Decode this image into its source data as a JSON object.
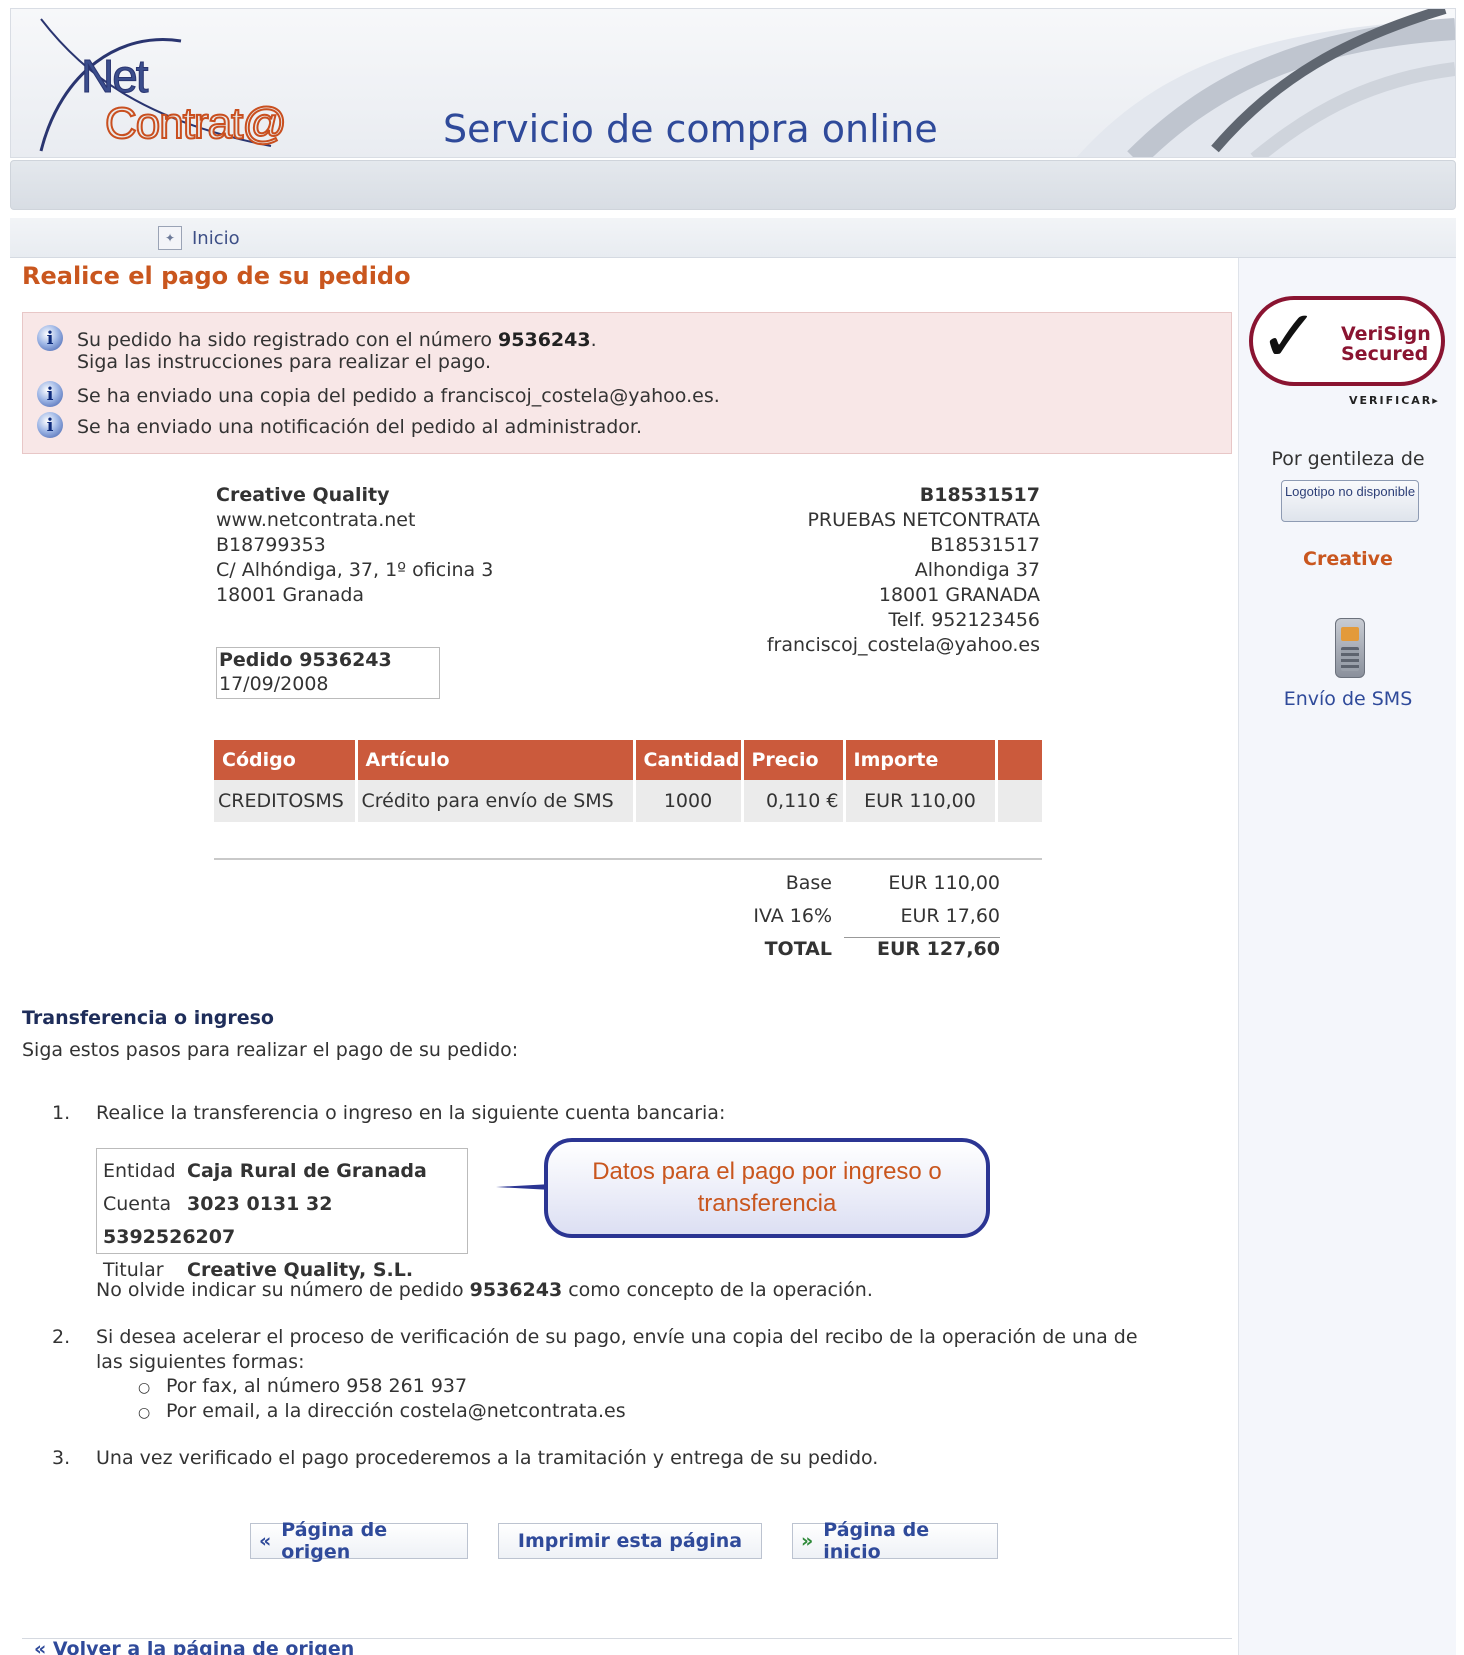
{
  "header": {
    "logo_top": "Net",
    "logo_bottom": "Contrat@",
    "title": "Servicio de compra online"
  },
  "nav": {
    "home_label": "Inicio"
  },
  "page_title": "Realice el pago de su pedido",
  "messages": {
    "m1_prefix": "Su pedido ha sido registrado con el número ",
    "m1_number": "9536243",
    "m1_suffix": ".",
    "m1_line2": "Siga las instrucciones para realizar el pago.",
    "m2": "Se ha enviado una copia del pedido a franciscoj_costela@yahoo.es.",
    "m3": "Se ha enviado una notificación del pedido al administrador."
  },
  "seller": {
    "name": "Creative Quality",
    "web": "www.netcontrata.net",
    "cif": "B18799353",
    "address": "C/ Alhóndiga, 37, 1º oficina 3",
    "city": "18001 Granada"
  },
  "buyer": {
    "id": "B18531517",
    "name": "PRUEBAS NETCONTRATA",
    "cif": "B18531517",
    "address": "Alhondiga 37",
    "city": "18001 GRANADA",
    "phone": "Telf. 952123456",
    "email": "franciscoj_costela@yahoo.es"
  },
  "order": {
    "label": "Pedido 9536243",
    "date": "17/09/2008"
  },
  "items_table": {
    "headers": [
      "Código",
      "Artículo",
      "Cantidad",
      "Precio",
      "Importe"
    ],
    "rows": [
      {
        "codigo": "CREDITOSMS",
        "articulo": "Crédito para envío de SMS",
        "cantidad": "1000",
        "precio": "0,110 €",
        "importe": "EUR 110,00"
      }
    ]
  },
  "totals": {
    "base_label": "Base",
    "base_value": "EUR 110,00",
    "iva_label": "IVA 16%",
    "iva_value": "EUR 17,60",
    "total_label": "TOTAL",
    "total_value": "EUR 127,60"
  },
  "payment": {
    "title": "Transferencia o ingreso",
    "intro": "Siga estos pasos para realizar el pago de su pedido:",
    "step1_num": "1.",
    "step1": "Realice la transferencia o ingreso en la siguiente cuenta bancaria:",
    "bank": {
      "entidad_label": "Entidad",
      "entidad": "Caja Rural de Granada",
      "cuenta_label": "Cuenta",
      "cuenta": "3023 0131 32 5392526207",
      "titular_label": "Titular",
      "titular": "Creative Quality, S.L."
    },
    "callout": "Datos para el pago por ingreso o transferencia",
    "reminder_prefix": "No olvide indicar su número de pedido ",
    "reminder_number": "9536243",
    "reminder_suffix": " como concepto de la operación.",
    "step2_num": "2.",
    "step2_line1": "Si desea acelerar el proceso de verificación de su pago, envíe una copia del recibo de la operación de una de",
    "step2_line2": "las siguientes formas:",
    "sub1": "Por fax, al número 958 261 937",
    "sub2": "Por email, a la dirección costela@netcontrata.es",
    "step3_num": "3.",
    "step3": "Una vez verificado el pago procederemos a la tramitación y entrega de su pedido."
  },
  "buttons": {
    "origin": "Página de origen",
    "print": "Imprimir esta página",
    "home": "Página de inicio"
  },
  "back_link": "« Volver a la página de origen",
  "sidebar": {
    "verisign_line1": "VeriSign",
    "verisign_line2": "Secured",
    "verify": "VERIFICAR▸",
    "courtesy": "Por gentileza de",
    "logo_placeholder": "Logotipo no disponible",
    "company": "Creative",
    "sms": "Envío de SMS"
  },
  "colors": {
    "accent_orange": "#c9561e",
    "table_header": "#cb5a3c",
    "link_blue": "#2f4a9a",
    "message_bg": "#f8e7e7"
  }
}
